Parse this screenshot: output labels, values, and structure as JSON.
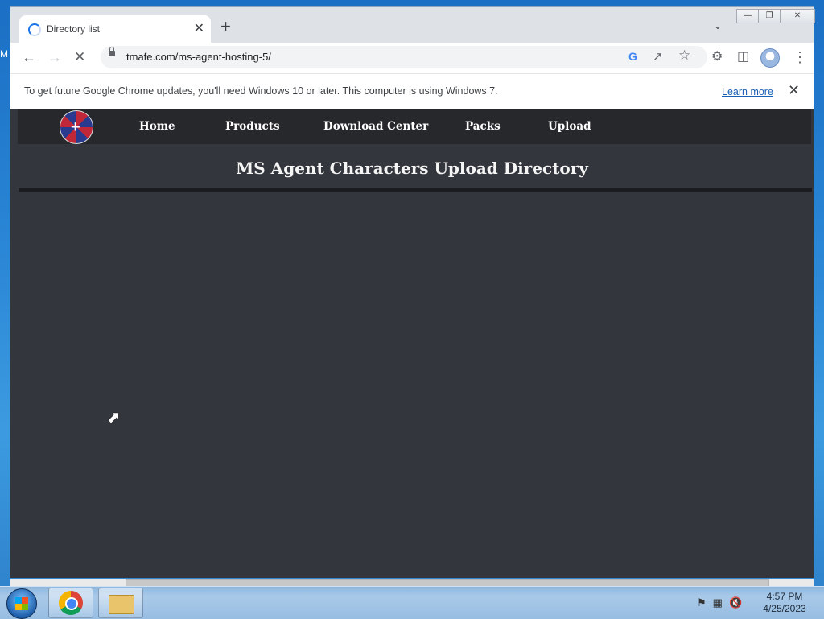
{
  "desktop": {
    "edge_text": "M"
  },
  "browser": {
    "tab": {
      "title": "Directory list",
      "close_glyph": "✕"
    },
    "new_tab_glyph": "+",
    "window_controls": {
      "minimize": "—",
      "restore": "❐",
      "close": "✕"
    },
    "toolbar": {
      "back_icon": "arrow-left-icon",
      "forward_icon": "arrow-right-icon",
      "stop_icon": "loading-stop-icon",
      "url": "tmafe.com/ms-agent-hosting-5/",
      "google_glyph": "G"
    },
    "infobar": {
      "message": "To get future Google Chrome updates, you'll need Windows 10 or later. This computer is using Windows 7.",
      "learn_more": "Learn more",
      "close_glyph": "✕"
    }
  },
  "site": {
    "nav": [
      {
        "label": "Home"
      },
      {
        "label": "Products"
      },
      {
        "label": "Download Center"
      },
      {
        "label": "Packs"
      },
      {
        "label": "Upload"
      }
    ],
    "title": "MS Agent Characters Upload Directory",
    "colors": {
      "page_bg": "#33363c",
      "nav_bg": "#26282c",
      "text": "#ffffff"
    }
  },
  "taskbar": {
    "clock": {
      "time": "4:57 PM",
      "date": "4/25/2023"
    }
  }
}
